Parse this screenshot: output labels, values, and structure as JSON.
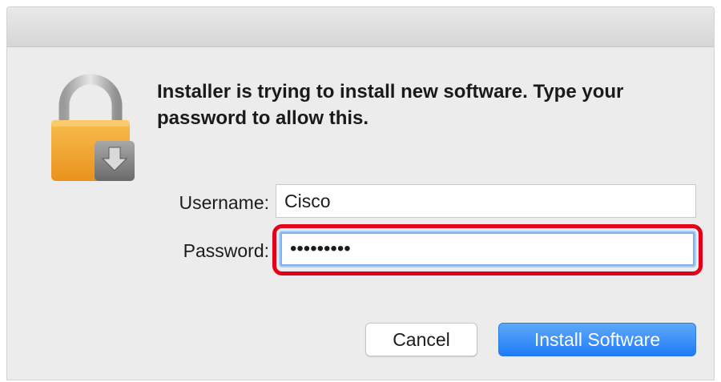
{
  "dialog": {
    "message": "Installer is trying to install new software. Type your password to allow this.",
    "icon": "lock-installer-icon"
  },
  "form": {
    "username_label": "Username:",
    "username_value": "Cisco",
    "password_label": "Password:",
    "password_value": "•••••••••"
  },
  "buttons": {
    "cancel_label": "Cancel",
    "install_label": "Install Software"
  },
  "colors": {
    "highlight": "#e3001b",
    "primary_button": "#1e7cf6",
    "lock_body": "#f2a62f"
  }
}
